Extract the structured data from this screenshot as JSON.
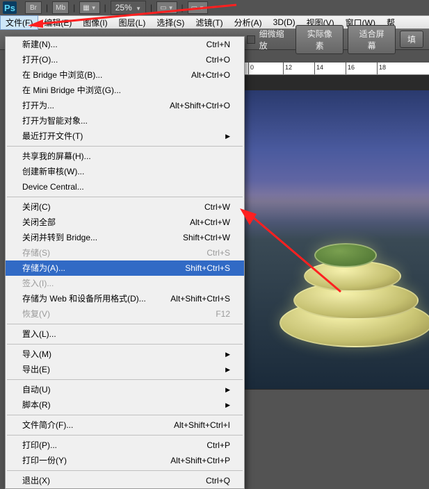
{
  "toolbar": {
    "logo": "Ps",
    "btn_br": "Br",
    "btn_mb": "Mb",
    "zoom": "25%"
  },
  "menubar": {
    "items": [
      "文件(F)",
      "编辑(E)",
      "图像(I)",
      "图层(L)",
      "选择(S)",
      "滤镜(T)",
      "分析(A)",
      "3D(D)",
      "视图(V)",
      "窗口(W)",
      "帮"
    ]
  },
  "options": {
    "checkbox_label": "细微缩放",
    "btn_actual": "实际像素",
    "btn_fit": "适合屏幕",
    "btn_fill": "填"
  },
  "ruler": {
    "marks": [
      "0",
      "12",
      "14",
      "16",
      "18"
    ]
  },
  "menu": {
    "groups": [
      [
        {
          "label": "新建(N)...",
          "shortcut": "Ctrl+N",
          "enabled": true
        },
        {
          "label": "打开(O)...",
          "shortcut": "Ctrl+O",
          "enabled": true
        },
        {
          "label": "在 Bridge 中浏览(B)...",
          "shortcut": "Alt+Ctrl+O",
          "enabled": true
        },
        {
          "label": "在 Mini Bridge 中浏览(G)...",
          "shortcut": "",
          "enabled": true
        },
        {
          "label": "打开为...",
          "shortcut": "Alt+Shift+Ctrl+O",
          "enabled": true
        },
        {
          "label": "打开为智能对象...",
          "shortcut": "",
          "enabled": true
        },
        {
          "label": "最近打开文件(T)",
          "shortcut": "",
          "enabled": true,
          "submenu": true
        }
      ],
      [
        {
          "label": "共享我的屏幕(H)...",
          "shortcut": "",
          "enabled": true
        },
        {
          "label": "创建新审核(W)...",
          "shortcut": "",
          "enabled": true
        },
        {
          "label": "Device Central...",
          "shortcut": "",
          "enabled": true
        }
      ],
      [
        {
          "label": "关闭(C)",
          "shortcut": "Ctrl+W",
          "enabled": true
        },
        {
          "label": "关闭全部",
          "shortcut": "Alt+Ctrl+W",
          "enabled": true
        },
        {
          "label": "关闭并转到 Bridge...",
          "shortcut": "Shift+Ctrl+W",
          "enabled": true
        },
        {
          "label": "存储(S)",
          "shortcut": "Ctrl+S",
          "enabled": false
        },
        {
          "label": "存储为(A)...",
          "shortcut": "Shift+Ctrl+S",
          "enabled": true,
          "highlighted": true
        },
        {
          "label": "签入(I)...",
          "shortcut": "",
          "enabled": false
        },
        {
          "label": "存储为 Web 和设备所用格式(D)...",
          "shortcut": "Alt+Shift+Ctrl+S",
          "enabled": true
        },
        {
          "label": "恢复(V)",
          "shortcut": "F12",
          "enabled": false
        }
      ],
      [
        {
          "label": "置入(L)...",
          "shortcut": "",
          "enabled": true
        }
      ],
      [
        {
          "label": "导入(M)",
          "shortcut": "",
          "enabled": true,
          "submenu": true
        },
        {
          "label": "导出(E)",
          "shortcut": "",
          "enabled": true,
          "submenu": true
        }
      ],
      [
        {
          "label": "自动(U)",
          "shortcut": "",
          "enabled": true,
          "submenu": true
        },
        {
          "label": "脚本(R)",
          "shortcut": "",
          "enabled": true,
          "submenu": true
        }
      ],
      [
        {
          "label": "文件简介(F)...",
          "shortcut": "Alt+Shift+Ctrl+I",
          "enabled": true
        }
      ],
      [
        {
          "label": "打印(P)...",
          "shortcut": "Ctrl+P",
          "enabled": true
        },
        {
          "label": "打印一份(Y)",
          "shortcut": "Alt+Shift+Ctrl+P",
          "enabled": true
        }
      ],
      [
        {
          "label": "退出(X)",
          "shortcut": "Ctrl+Q",
          "enabled": true
        }
      ]
    ]
  }
}
